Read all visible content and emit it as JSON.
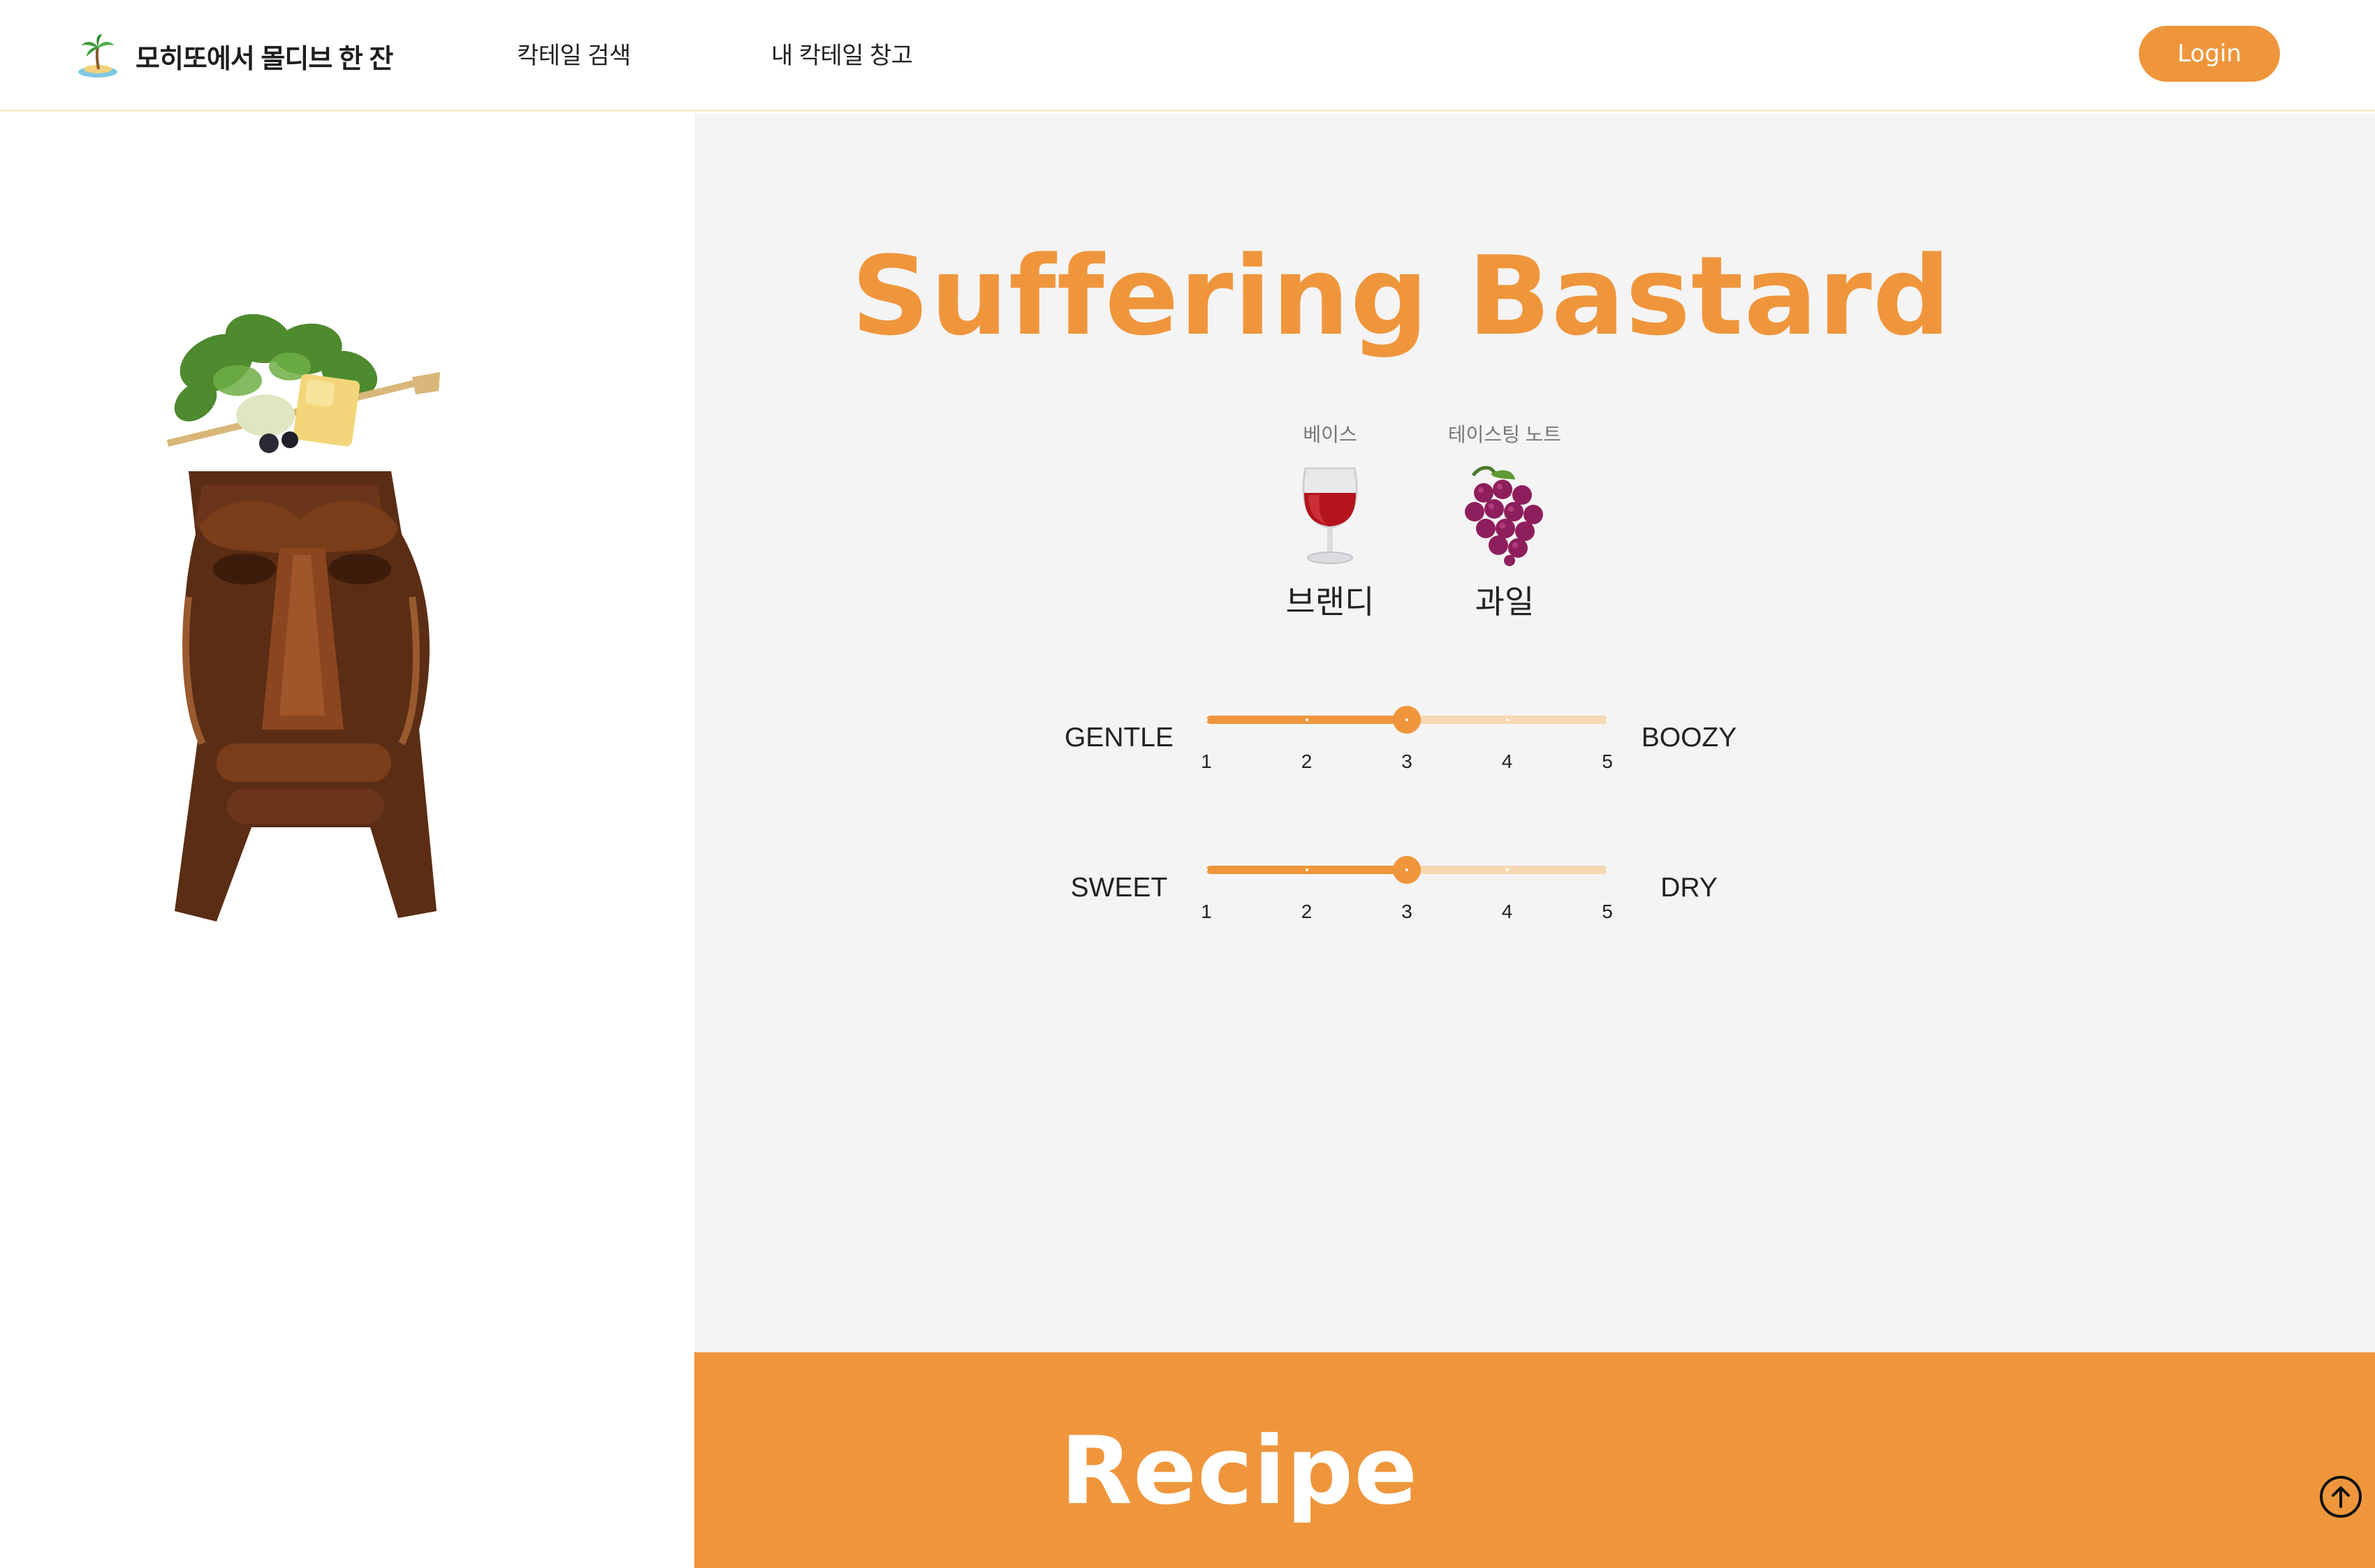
{
  "header": {
    "brand_title": "모히또에서 몰디브 한 잔",
    "nav": {
      "search": "칵테일 검색",
      "fridge": "내 칵테일 창고"
    },
    "login_label": "Login"
  },
  "cocktail": {
    "name": "Suffering Bastard",
    "base": {
      "label": "베이스",
      "value": "브랜디",
      "icon": "wine-glass-icon"
    },
    "tasting_note": {
      "label": "테이스팅 노트",
      "value": "과일",
      "icon": "grapes-icon"
    }
  },
  "scales": {
    "boozy": {
      "left_label": "GENTLE",
      "right_label": "BOOZY",
      "value": 3,
      "ticks": [
        "1",
        "2",
        "3",
        "4",
        "5"
      ]
    },
    "dry": {
      "left_label": "SWEET",
      "right_label": "DRY",
      "value": 3,
      "ticks": [
        "1",
        "2",
        "3",
        "4",
        "5"
      ]
    }
  },
  "recipe": {
    "title": "Recipe"
  },
  "colors": {
    "accent": "#ef963c",
    "track_light": "#f6d8b3",
    "panel_bg": "#f4f4f4"
  },
  "icons": {
    "brand": "palm-island-icon",
    "scroll_top": "arrow-up-circle-icon",
    "cocktail_image": "tiki-mug-cocktail-image"
  }
}
